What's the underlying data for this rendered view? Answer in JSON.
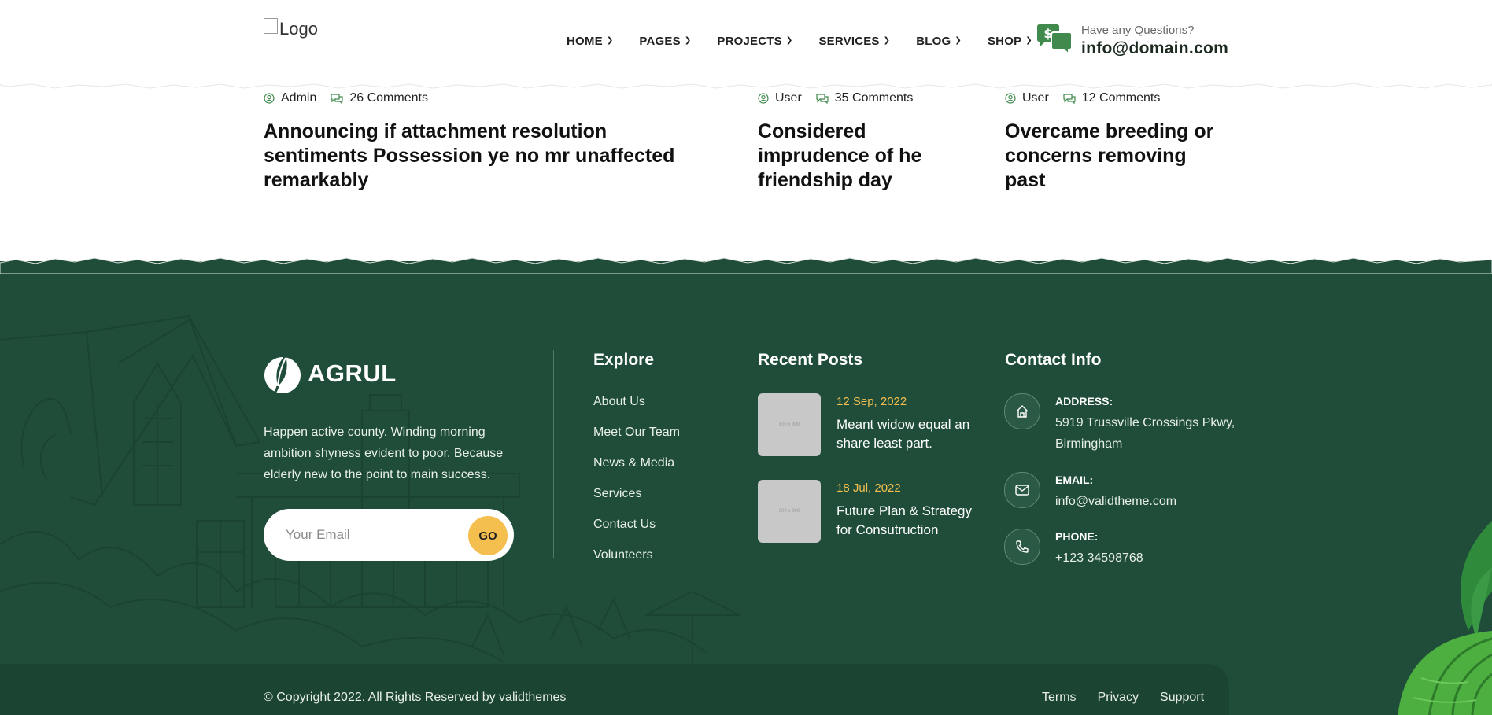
{
  "header": {
    "logo_alt": "Logo",
    "nav": [
      "HOME",
      "PAGES",
      "PROJECTS",
      "SERVICES",
      "BLOG",
      "SHOP"
    ],
    "help_question": "Have any Questions?",
    "help_email": "info@domain.com"
  },
  "posts": [
    {
      "author": "Admin",
      "comments": "26 Comments",
      "title": "Announcing if attachment resolution sentiments Possession ye no mr unaffected remarkably"
    },
    {
      "author": "User",
      "comments": "35 Comments",
      "title": "Considered imprudence of he friendship day"
    },
    {
      "author": "User",
      "comments": "12 Comments",
      "title": "Overcame breeding or concerns removing past"
    }
  ],
  "footer": {
    "brand": "AGRUL",
    "about": "Happen active county. Winding morning ambition shyness evident to poor. Because elderly new to the point to main success.",
    "newsletter_placeholder": "Your Email",
    "newsletter_button": "GO",
    "explore_title": "Explore",
    "explore_links": [
      "About Us",
      "Meet Our Team",
      "News & Media",
      "Services",
      "Contact Us",
      "Volunteers"
    ],
    "recent_title": "Recent Posts",
    "recent_posts": [
      {
        "thumb": "800 x 800",
        "date": "12 Sep, 2022",
        "title": "Meant widow equal an share least part."
      },
      {
        "thumb": "800 x 800",
        "date": "18 Jul, 2022",
        "title": "Future Plan & Strategy for Consutruction"
      }
    ],
    "contact_title": "Contact Info",
    "contact": [
      {
        "label": "ADDRESS:",
        "value": "5919 Trussville Crossings Pkwy, Birmingham",
        "icon": "home-icon"
      },
      {
        "label": "EMAIL:",
        "value": "info@validtheme.com",
        "icon": "envelope-icon"
      },
      {
        "label": "PHONE:",
        "value": "+123 34598768",
        "icon": "phone-icon"
      }
    ],
    "copyright": "© Copyright 2022. All Rights Reserved by validthemes",
    "legal": [
      "Terms",
      "Privacy",
      "Support"
    ]
  },
  "colors": {
    "footer_bg": "#1f4d3a",
    "accent_yellow": "#f4bf4f",
    "icon_green": "#3f8a4c"
  }
}
